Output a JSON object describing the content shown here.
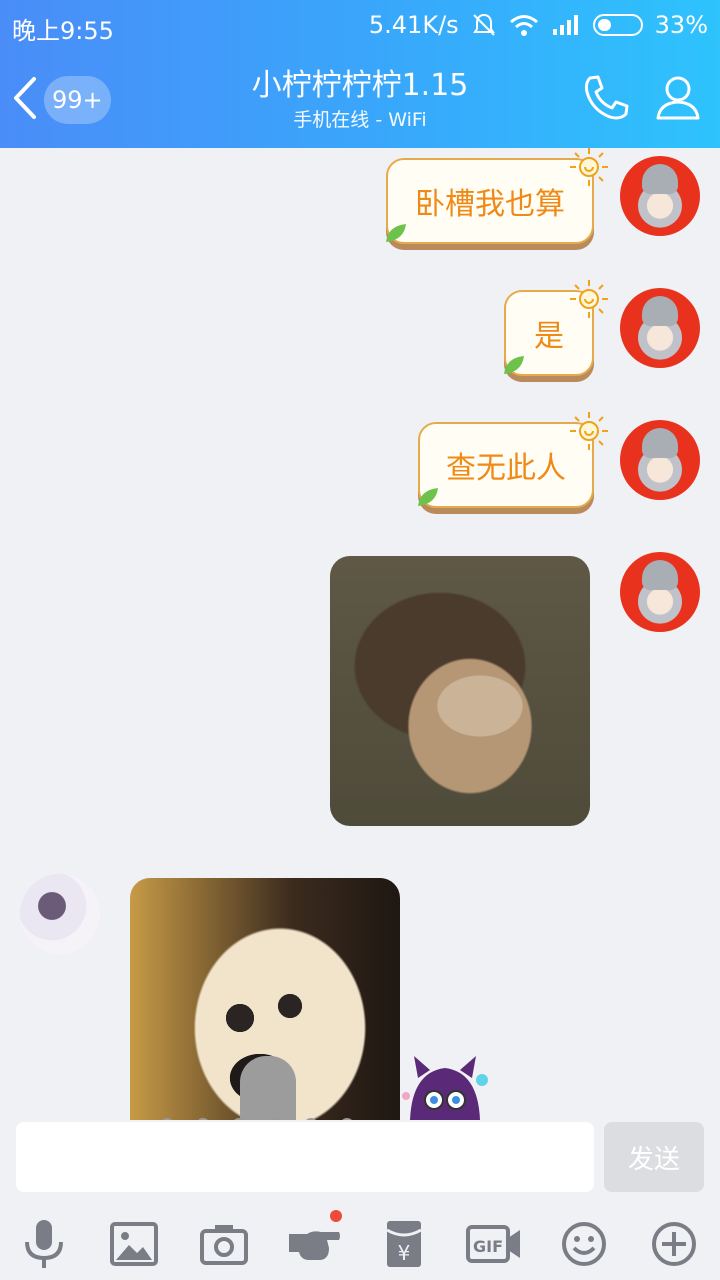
{
  "status_bar": {
    "time": "晚上9:55",
    "net_speed": "5.41K/s",
    "battery_percent": "33%",
    "battery_level": 0.33,
    "icons": [
      "mute-bell-icon",
      "wifi-icon",
      "signal-icon",
      "battery-icon"
    ]
  },
  "header": {
    "unread_badge": "99+",
    "title": "小柠柠柠柠1.15",
    "subtitle": "手机在线 - WiFi"
  },
  "messages": [
    {
      "sender": "me",
      "type": "text",
      "text": "卧槽我也算"
    },
    {
      "sender": "me",
      "type": "text",
      "text": "是"
    },
    {
      "sender": "me",
      "type": "text",
      "text": "查无此人"
    },
    {
      "sender": "me",
      "type": "image",
      "subject": "child-photo"
    },
    {
      "sender": "other",
      "type": "image",
      "subject": "dog-photo"
    }
  ],
  "input": {
    "placeholder": "",
    "send_label": "发送"
  },
  "toolbar": {
    "items": [
      "microphone-icon",
      "image-icon",
      "camera-icon",
      "poke-hand-icon",
      "red-packet-icon",
      "gif-icon",
      "emoji-icon",
      "plus-icon"
    ],
    "notification_on": "poke-hand-icon"
  },
  "colors": {
    "header_start": "#4a8df8",
    "header_end": "#2ec3fd",
    "bubble_text": "#ef8a16",
    "bubble_border": "#e5ab4a",
    "background": "#f0f1f5"
  }
}
